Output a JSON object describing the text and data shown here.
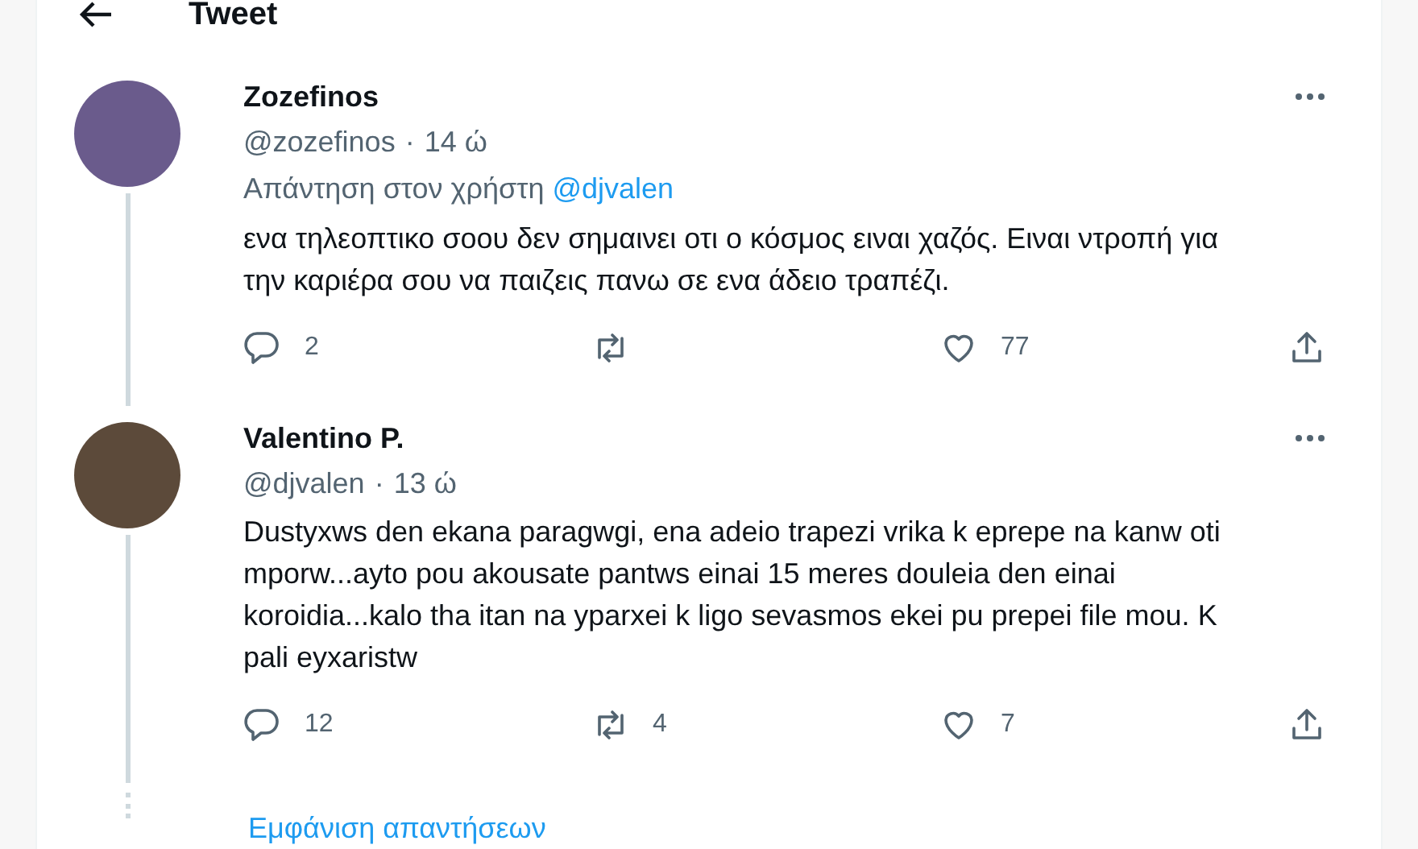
{
  "header": {
    "title": "Tweet"
  },
  "tweets": [
    {
      "name": "Zozefinos",
      "handle": "@zozefinos",
      "separator": "·",
      "time": "14 ώ",
      "reply_to": {
        "prefix": "Απάντηση στον χρήστη",
        "user": "@djvalen"
      },
      "text": "ενα τηλεοπτικο σοου δεν σημαινει οτι ο κόσμος ειναι χαζός. Ειναι ντροπή για την καριέρα σου να παιζεις πανω σε ενα άδειο τραπέζι.",
      "actions": [
        {
          "kind": "reply",
          "count": "2"
        },
        {
          "kind": "retweet"
        },
        {
          "kind": "like",
          "count": "77"
        },
        {
          "kind": "share"
        }
      ]
    },
    {
      "name": "Valentino P.",
      "handle": "@djvalen",
      "separator": "·",
      "time": "13 ώ",
      "text": "Dustyxws den ekana paragwgi, ena adeio trapezi vrika k eprepe na kanw oti mporw...ayto pou akousate pantws einai 15 meres douleia den einai koroidia...kalo tha itan na yparxei k ligo sevasmos ekei pu prepei file mou. K pali eyxaristw",
      "actions": [
        {
          "kind": "reply",
          "count": "12"
        },
        {
          "kind": "retweet",
          "count": "4"
        },
        {
          "kind": "like",
          "count": "7"
        },
        {
          "kind": "share"
        }
      ]
    }
  ],
  "show_replies": "Εμφάνιση απαντήσεων"
}
